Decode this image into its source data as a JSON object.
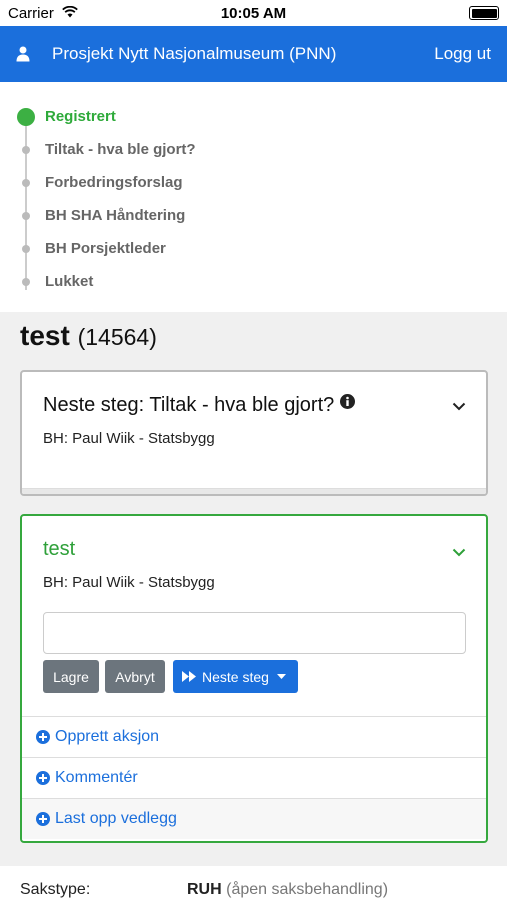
{
  "status_bar": {
    "carrier": "Carrier",
    "time": "10:05 AM"
  },
  "navbar": {
    "title": "Prosjekt Nytt Nasjonalmuseum (PNN)",
    "logout": "Logg ut",
    "bg_color": "#1b6fdc"
  },
  "steps": [
    {
      "label": "Registrert",
      "active": true
    },
    {
      "label": "Tiltak - hva ble gjort?",
      "active": false
    },
    {
      "label": "Forbedringsforslag",
      "active": false
    },
    {
      "label": "BH SHA Håndtering",
      "active": false
    },
    {
      "label": "BH Porsjektleder",
      "active": false
    },
    {
      "label": "Lukket",
      "active": false
    }
  ],
  "case": {
    "title": "test",
    "id": "(14564)"
  },
  "next_card": {
    "title": "Neste steg: Tiltak - hva ble gjort?",
    "bh": "BH: Paul Wiik - Statsbygg"
  },
  "active_card": {
    "title": "test",
    "bh": "BH: Paul Wiik - Statsbygg",
    "input_value": "",
    "save_label": "Lagre",
    "cancel_label": "Avbryt",
    "next_label": "Neste steg",
    "actions": [
      "Opprett aksjon",
      "Kommentér",
      "Last opp vedlegg"
    ]
  },
  "info": {
    "label": "Sakstype:",
    "value": "RUH",
    "value_note": "(åpen saksbehandling)"
  },
  "colors": {
    "accent": "#1b6fdc",
    "success": "#35a83e"
  }
}
